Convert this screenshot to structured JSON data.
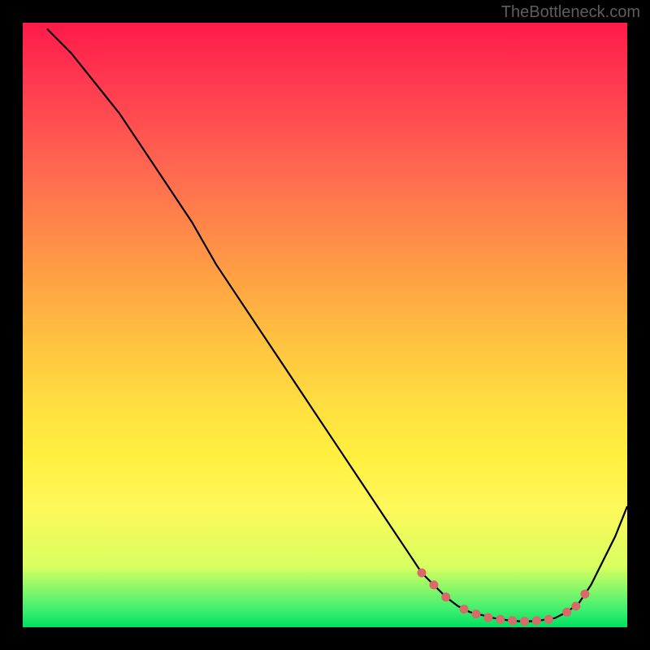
{
  "watermark": "TheBottleneck.com",
  "chart_data": {
    "type": "line",
    "title": "",
    "xlabel": "",
    "ylabel": "",
    "xlim": [
      0,
      100
    ],
    "ylim": [
      0,
      100
    ],
    "series": [
      {
        "name": "curve",
        "x": [
          4,
          8,
          12,
          16,
          20,
          24,
          28,
          32,
          36,
          40,
          44,
          48,
          52,
          56,
          60,
          64,
          66,
          68,
          70,
          72,
          74,
          76,
          78,
          80,
          82,
          84,
          86,
          88,
          90,
          92,
          94,
          96,
          98,
          100
        ],
        "y": [
          99,
          95,
          90,
          85,
          79,
          73,
          67,
          60,
          54,
          48,
          42,
          36,
          30,
          24,
          18,
          12,
          9,
          7,
          5,
          3.5,
          2.5,
          2,
          1.5,
          1.2,
          1,
          1,
          1.2,
          1.5,
          2.5,
          4,
          7,
          11,
          15,
          20
        ]
      }
    ],
    "markers": {
      "name": "highlight-dots",
      "color": "#d86a6a",
      "points": [
        {
          "x": 66,
          "y": 9
        },
        {
          "x": 68,
          "y": 7
        },
        {
          "x": 70,
          "y": 5
        },
        {
          "x": 73,
          "y": 3
        },
        {
          "x": 75,
          "y": 2.2
        },
        {
          "x": 77,
          "y": 1.6
        },
        {
          "x": 79,
          "y": 1.3
        },
        {
          "x": 81,
          "y": 1.1
        },
        {
          "x": 83,
          "y": 1
        },
        {
          "x": 85,
          "y": 1.1
        },
        {
          "x": 87,
          "y": 1.3
        },
        {
          "x": 90,
          "y": 2.5
        },
        {
          "x": 91.5,
          "y": 3.5
        },
        {
          "x": 93,
          "y": 5.5
        }
      ]
    },
    "gradient_stops": [
      {
        "pos": 0,
        "color": "#ff1a4a"
      },
      {
        "pos": 50,
        "color": "#ffc040"
      },
      {
        "pos": 80,
        "color": "#fff85a"
      },
      {
        "pos": 100,
        "color": "#00e060"
      }
    ]
  }
}
